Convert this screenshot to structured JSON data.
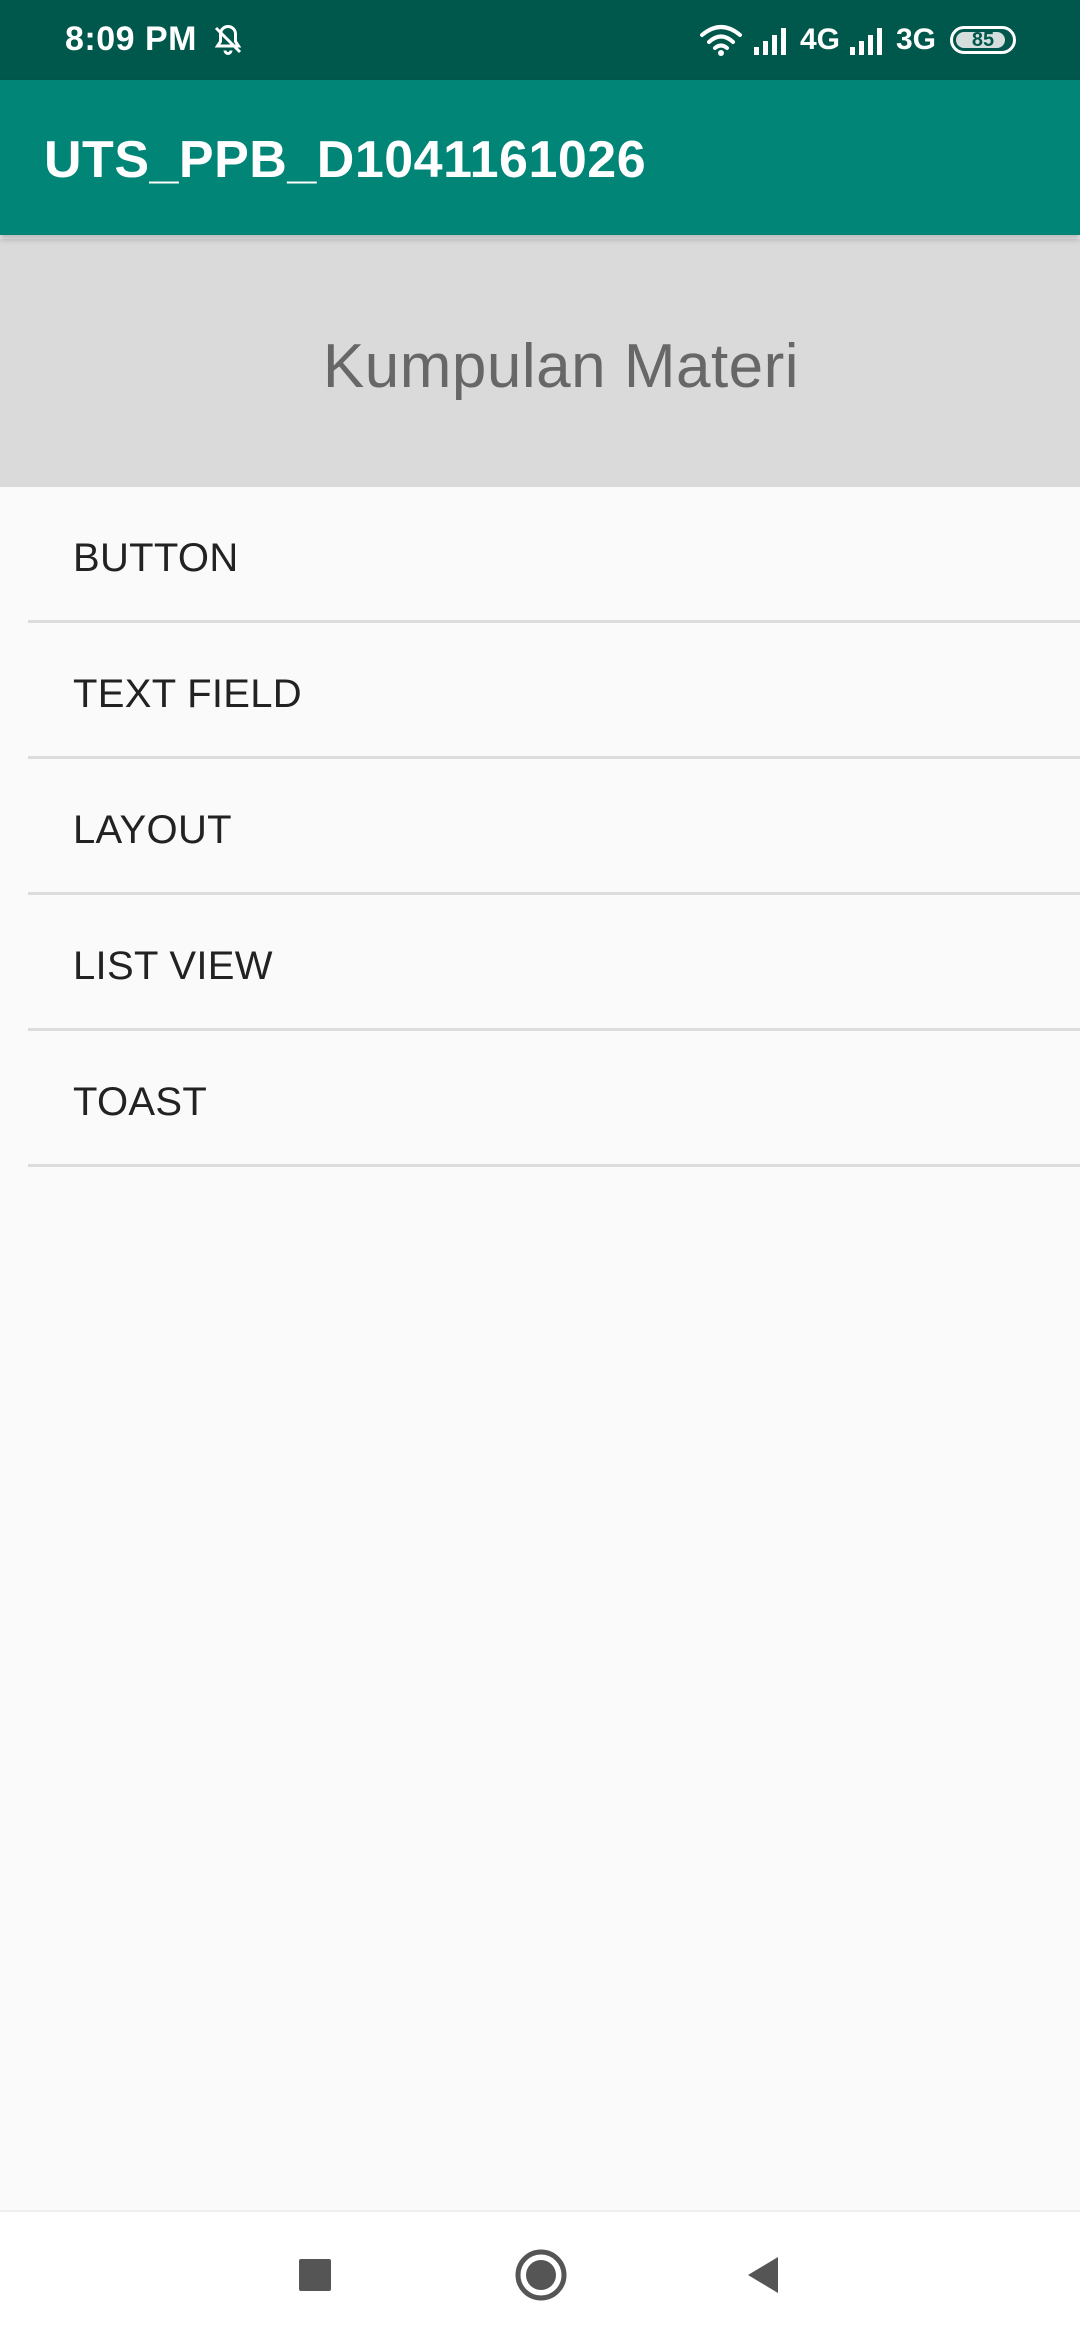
{
  "status_bar": {
    "time": "8:09 PM",
    "network_1": "4G",
    "network_2": "3G",
    "battery_level": "85",
    "icons": [
      "mute-icon",
      "wifi-icon",
      "signal-icon",
      "signal-icon",
      "battery-icon"
    ]
  },
  "app_bar": {
    "title": "UTS_PPB_D1041161026"
  },
  "header": {
    "title": "Kumpulan Materi"
  },
  "list": {
    "items": [
      {
        "label": "BUTTON"
      },
      {
        "label": "TEXT FIELD"
      },
      {
        "label": "LAYOUT"
      },
      {
        "label": "LIST VIEW"
      },
      {
        "label": "TOAST"
      }
    ]
  },
  "nav_bar": {
    "icons": [
      "recents-icon",
      "home-icon",
      "back-icon"
    ]
  },
  "colors": {
    "status_bar": "#00574b",
    "app_bar": "#008577",
    "header_bg": "#dadada",
    "header_text": "#676767",
    "list_bg": "#fafafa"
  }
}
